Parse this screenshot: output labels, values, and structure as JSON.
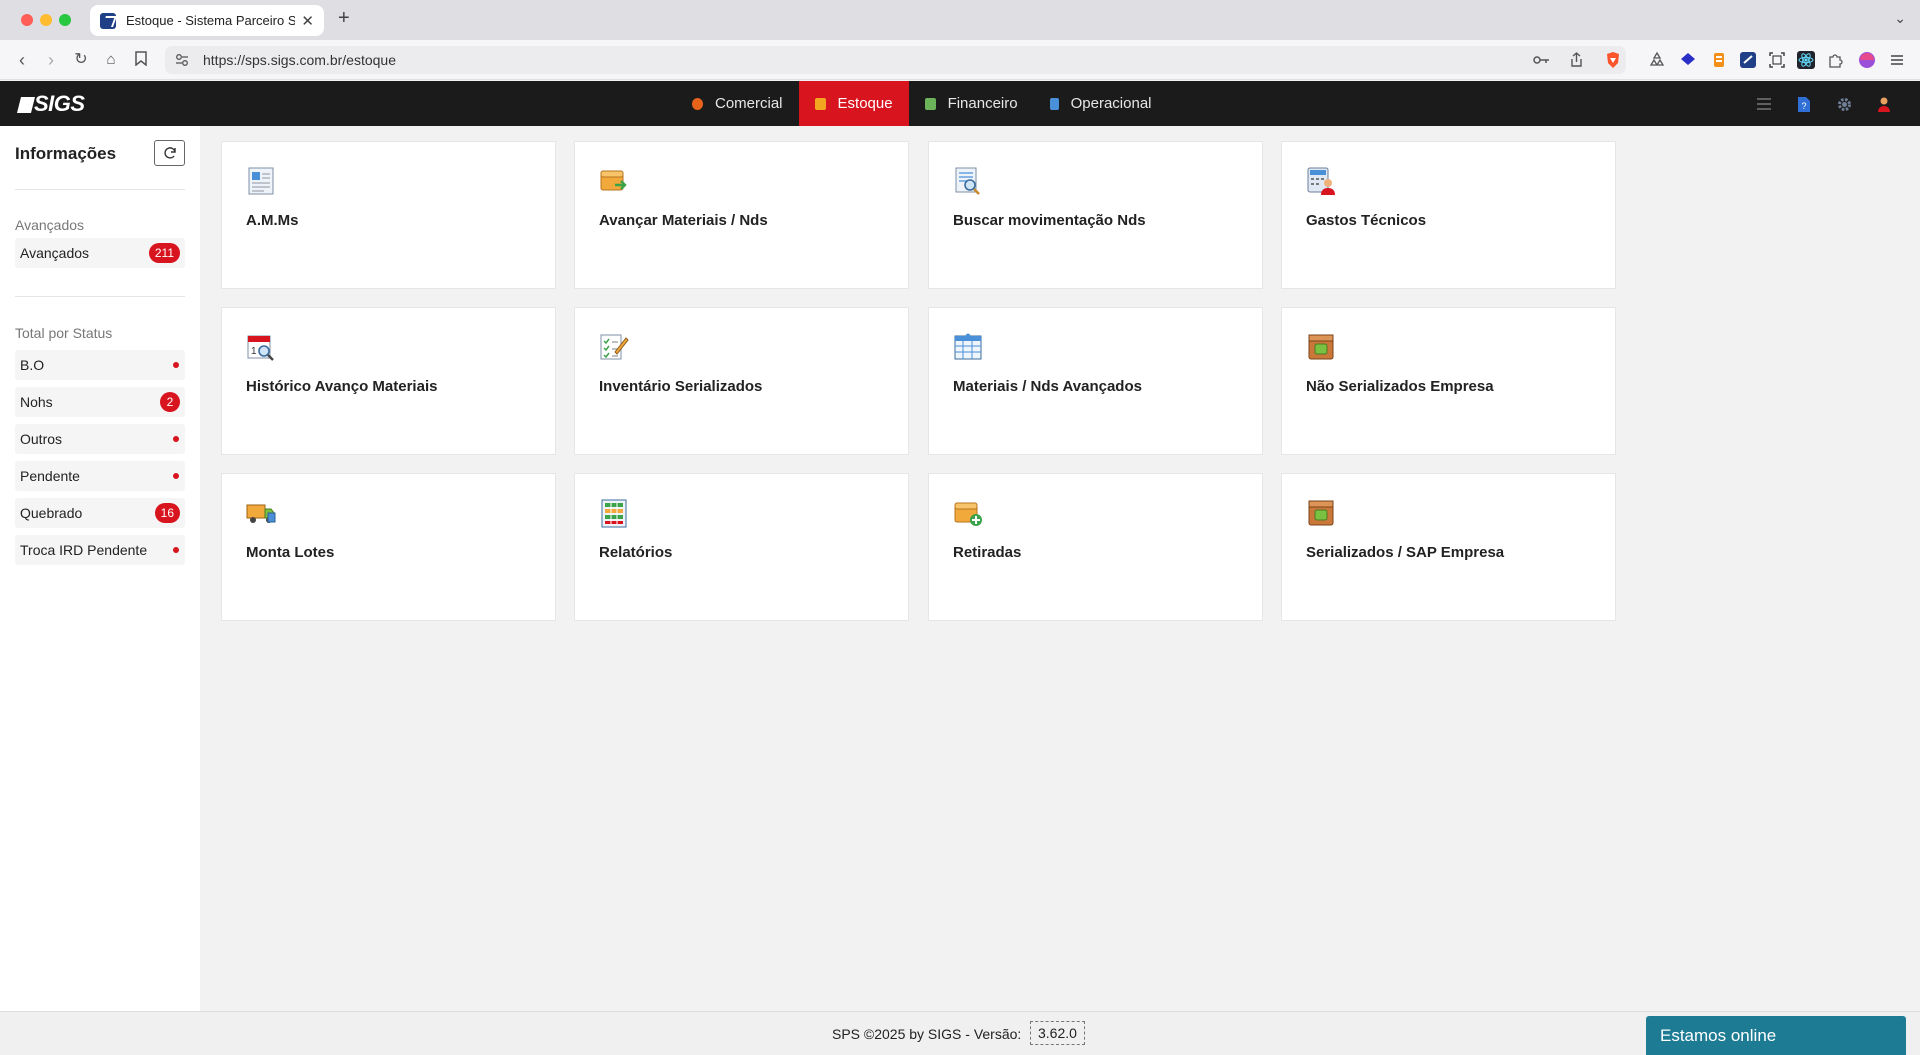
{
  "browser": {
    "tab_title": "Estoque - Sistema Parceiro S",
    "tab_close": "✕",
    "new_tab": "+",
    "url": "https://sps.sigs.com.br/estoque"
  },
  "app": {
    "logo": "SIGS",
    "modules": [
      {
        "label": "Comercial",
        "color": "#e8621a"
      },
      {
        "label": "Estoque",
        "color": "#f2a51f"
      },
      {
        "label": "Financeiro",
        "color": "#6cb35a"
      },
      {
        "label": "Operacional",
        "color": "#4a90d9"
      }
    ],
    "active_module": "Estoque"
  },
  "sidebar": {
    "title": "Informações",
    "refresh_icon": "refresh-icon",
    "section_advanced": "Avançados",
    "advanced_items": [
      {
        "label": "Avançados",
        "badge": "211"
      }
    ],
    "section_status": "Total por Status",
    "status_items": [
      {
        "label": "B.O",
        "badge": ""
      },
      {
        "label": "Nohs",
        "badge": "2"
      },
      {
        "label": "Outros",
        "badge": ""
      },
      {
        "label": "Pendente",
        "badge": ""
      },
      {
        "label": "Quebrado",
        "badge": "16"
      },
      {
        "label": "Troca IRD Pendente",
        "badge": ""
      }
    ]
  },
  "cards": [
    {
      "label": "A.M.Ms",
      "icon": "document-tag-icon"
    },
    {
      "label": "Avançar Materiais / Nds",
      "icon": "box-arrow-icon"
    },
    {
      "label": "Buscar movimentação Nds",
      "icon": "search-document-icon"
    },
    {
      "label": "Gastos Técnicos",
      "icon": "calculator-user-icon"
    },
    {
      "label": "Histórico Avanço Materiais",
      "icon": "calendar-search-icon"
    },
    {
      "label": "Inventário Serializados",
      "icon": "checklist-pencil-icon"
    },
    {
      "label": "Materiais / Nds Avançados",
      "icon": "table-grid-icon"
    },
    {
      "label": "Não Serializados Empresa",
      "icon": "package-icon"
    },
    {
      "label": "Monta Lotes",
      "icon": "truck-icon"
    },
    {
      "label": "Relatórios",
      "icon": "report-icon"
    },
    {
      "label": "Retiradas",
      "icon": "box-add-icon"
    },
    {
      "label": "Serializados / SAP Empresa",
      "icon": "package-icon"
    }
  ],
  "footer": {
    "text": "SPS ©2025 by SIGS - Versão:",
    "version": "3.62.0",
    "chat": "Estamos online"
  }
}
